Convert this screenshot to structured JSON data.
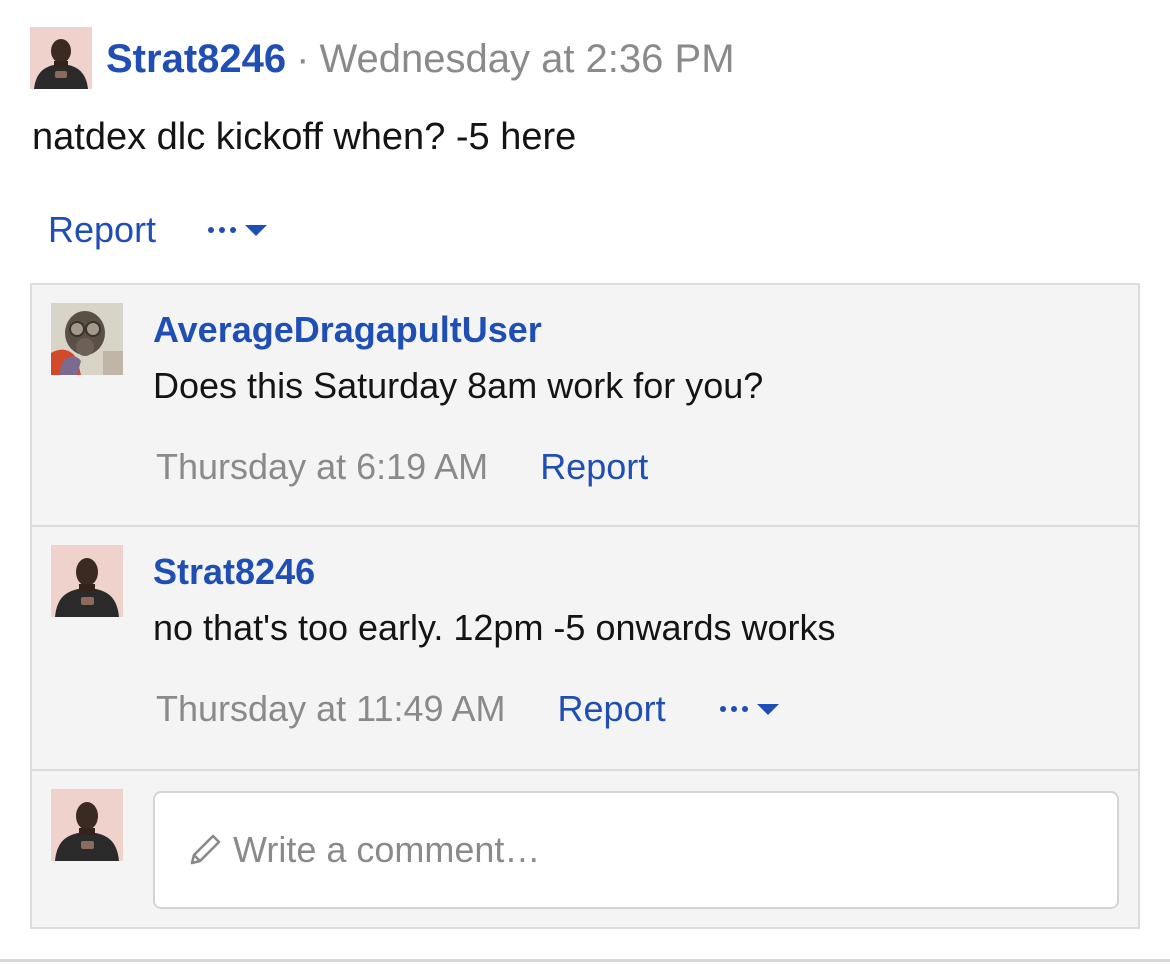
{
  "post": {
    "author": "Strat8246",
    "separator": "·",
    "timestamp": "Wednesday at 2:36 PM",
    "body": "natdex dlc kickoff when? -5 here",
    "actions": {
      "report_label": "Report",
      "more_icon": "more-options-icon"
    },
    "avatar_icon": "user-avatar-strat8246"
  },
  "comments": [
    {
      "author": "AverageDragapultUser",
      "text": "Does this Saturday 8am work for you?",
      "timestamp": "Thursday at 6:19 AM",
      "report_label": "Report",
      "avatar_icon": "user-avatar-gasmask"
    },
    {
      "author": "Strat8246",
      "text": "no that's too early. 12pm -5 onwards works",
      "timestamp": "Thursday at 11:49 AM",
      "report_label": "Report",
      "more_icon": "more-options-icon",
      "avatar_icon": "user-avatar-strat8246"
    }
  ],
  "comment_input": {
    "placeholder": "Write a comment…",
    "icon": "pencil-icon",
    "avatar_icon": "user-avatar-strat8246"
  },
  "colors": {
    "link": "#1f4eb4",
    "muted": "#8a8a8a",
    "text": "#141414",
    "panel_bg": "#f4f4f4",
    "border": "#dcdcdc"
  }
}
